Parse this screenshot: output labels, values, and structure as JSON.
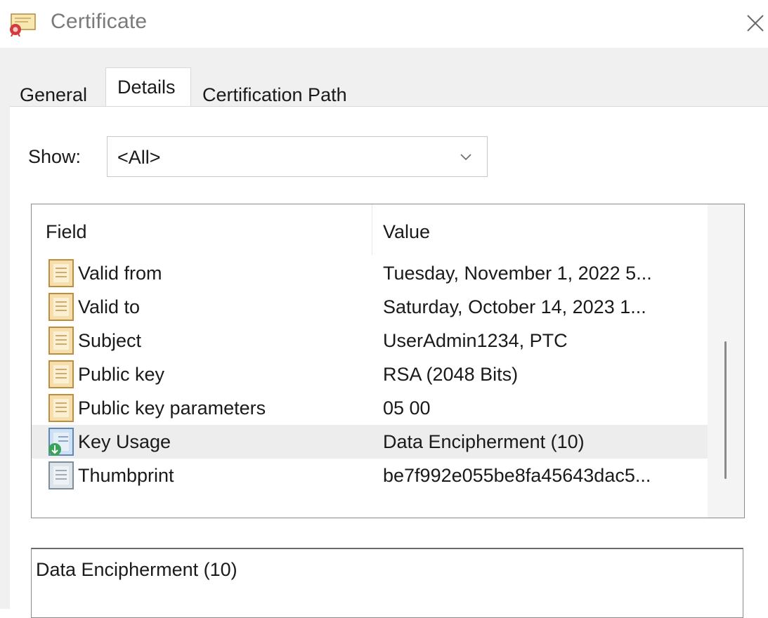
{
  "window": {
    "title": "Certificate",
    "icon": "certificate-icon",
    "close_icon": "close-icon"
  },
  "tabs": [
    {
      "label": "General",
      "selected": false
    },
    {
      "label": "Details",
      "selected": true
    },
    {
      "label": "Certification Path",
      "selected": false
    }
  ],
  "show": {
    "label": "Show:",
    "value": "<All>"
  },
  "fields_list": {
    "columns": [
      "Field",
      "Value"
    ],
    "rows": [
      {
        "field": "Valid from",
        "value": "Tuesday, November 1, 2022 5...",
        "icon": "field-doc-icon",
        "selected": false
      },
      {
        "field": "Valid to",
        "value": "Saturday, October 14, 2023 1...",
        "icon": "field-doc-icon",
        "selected": false
      },
      {
        "field": "Subject",
        "value": "UserAdmin1234, PTC",
        "icon": "field-doc-icon",
        "selected": false
      },
      {
        "field": "Public key",
        "value": "RSA (2048 Bits)",
        "icon": "field-doc-icon",
        "selected": false
      },
      {
        "field": "Public key parameters",
        "value": "05 00",
        "icon": "field-doc-icon",
        "selected": false
      },
      {
        "field": "Key Usage",
        "value": "Data Encipherment (10)",
        "icon": "extension-icon",
        "selected": true
      },
      {
        "field": "Thumbprint",
        "value": "be7f992e055be8fa45643dac5...",
        "icon": "thumbprint-icon",
        "selected": false
      }
    ]
  },
  "detail": {
    "text": "Data Encipherment (10)"
  },
  "colors": {
    "dialog_bg": "#f0f0f0",
    "selected_row": "#ededed",
    "title_text": "#7a7a7a"
  }
}
